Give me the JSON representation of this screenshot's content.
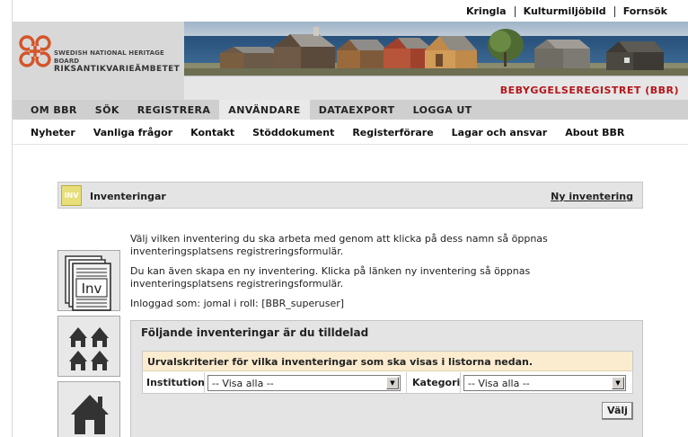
{
  "toplinks": [
    "Kringla",
    "Kulturmiljöbild",
    "Fornsök"
  ],
  "logo": {
    "line1": "SWEDISH NATIONAL HERITAGE BOARD",
    "line2": "RIKSANTIKVARIEÄMBETET"
  },
  "header": {
    "site_name": "BEBYGGELSEREGISTRET (BBR)"
  },
  "mainnav": [
    "OM BBR",
    "SÖK",
    "REGISTRERA",
    "ANVÄNDARE",
    "DATAEXPORT",
    "LOGGA UT"
  ],
  "subnav": [
    "Nyheter",
    "Vanliga frågor",
    "Kontakt",
    "Stöddokument",
    "Registerförare",
    "Lagar och ansvar",
    "About BBR"
  ],
  "page": {
    "badge": "INV",
    "title": "Inventeringar",
    "new_link": "Ny inventering"
  },
  "intro": {
    "p1": "Välj vilken inventering du ska arbeta med genom att klicka på dess namn så öppnas inventeringsplatsens registreringsformulär.",
    "p2": "Du kan även skapa en ny inventering. Klicka på länken ny inventering så öppnas inventeringsplatsens registreringsformulär.",
    "p3": "Inloggad som: jomal i roll: [BBR_superuser]"
  },
  "side_icons": {
    "inv_label": "Inv"
  },
  "panel": {
    "title": "Följande inventeringar är du tilldelad",
    "filter_head": "Urvalskriterier för vilka inventeringar som ska visas i listorna nedan.",
    "institution_label": "Institution",
    "institution_value": "-- Visa alla --",
    "kategori_label": "Kategori",
    "kategori_value": "-- Visa alla --",
    "button": "Välj"
  },
  "colors": {
    "brand_red": "#b4161a",
    "logo_orange": "#d4552a",
    "filter_head_bg": "#fbecd0",
    "badge_yellow": "#e8df7a"
  }
}
